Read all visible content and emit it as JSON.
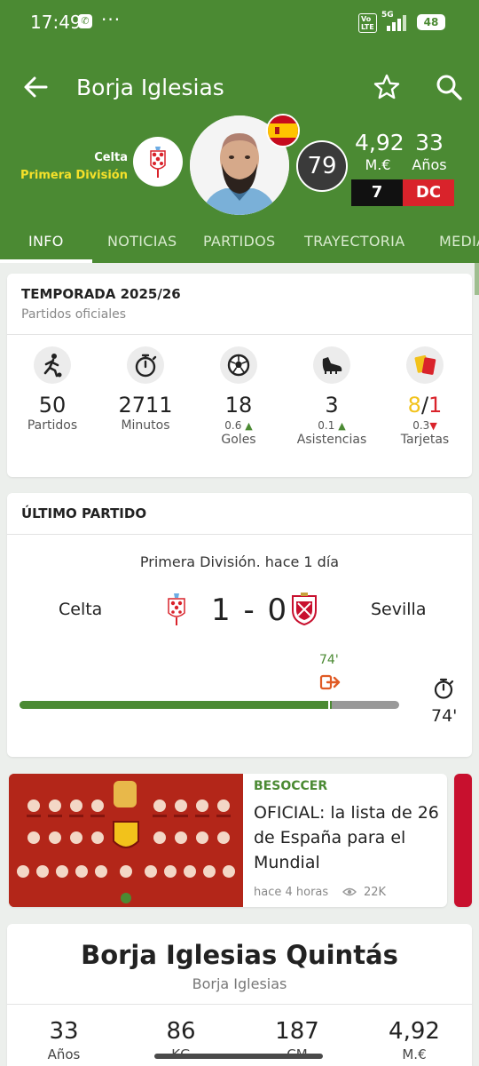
{
  "status_bar": {
    "time": "17:49",
    "dots": "···",
    "network": "5G",
    "volte": "Vo LTE",
    "battery": "48"
  },
  "header": {
    "player_name": "Borja Iglesias",
    "club": "Celta",
    "league": "Primera División",
    "rating": "79",
    "value": "4,92",
    "value_unit": "M.€",
    "age": "33",
    "age_unit": "Años",
    "shirt_number": "7",
    "position": "DC",
    "colors": {
      "header_bg": "#4b8a33",
      "league_text": "#f5e12a",
      "position_bg": "#d9232b"
    }
  },
  "tabs": [
    {
      "label": "INFO",
      "active": true
    },
    {
      "label": "NOTICIAS"
    },
    {
      "label": "PARTIDOS"
    },
    {
      "label": "TRAYECTORIA"
    },
    {
      "label": "MEDIA"
    }
  ],
  "season": {
    "title": "TEMPORADA 2025/26",
    "subtitle": "Partidos oficiales",
    "stats": [
      {
        "icon": "player-kick-icon",
        "value": "50",
        "label": "Partidos"
      },
      {
        "icon": "stopwatch-icon",
        "value": "2711",
        "label": "Minutos"
      },
      {
        "icon": "soccer-ball-icon",
        "value": "18",
        "delta": "0.6",
        "trend": "up",
        "label": "Goles"
      },
      {
        "icon": "boot-icon",
        "value": "3",
        "delta": "0.1",
        "trend": "up",
        "label": "Asistencias"
      },
      {
        "icon": "cards-icon",
        "value_yellow": "8",
        "separator": "/",
        "value_red": "1",
        "delta": "0.3",
        "trend": "down",
        "label": "Tarjetas"
      }
    ]
  },
  "last_match": {
    "title": "ÚLTIMO PARTIDO",
    "meta": "Primera División. hace 1 día",
    "home_team": "Celta",
    "away_team": "Sevilla",
    "score": "1 - 0",
    "sub_minute": "74'",
    "minutes_played": "74'",
    "played_fraction": 0.822
  },
  "news": {
    "source": "BESOCCER",
    "title": "OFICIAL: la lista de 26 de España para el Mundial",
    "time": "hace 4 horas",
    "views": "22K"
  },
  "bio": {
    "full_name": "Borja Iglesias Quintás",
    "short_name": "Borja Iglesias",
    "stats": [
      {
        "value": "33",
        "label": "Años"
      },
      {
        "value": "86",
        "label": "KG"
      },
      {
        "value": "187",
        "label": "CM"
      },
      {
        "value": "4,92",
        "label": "M.€"
      }
    ]
  }
}
